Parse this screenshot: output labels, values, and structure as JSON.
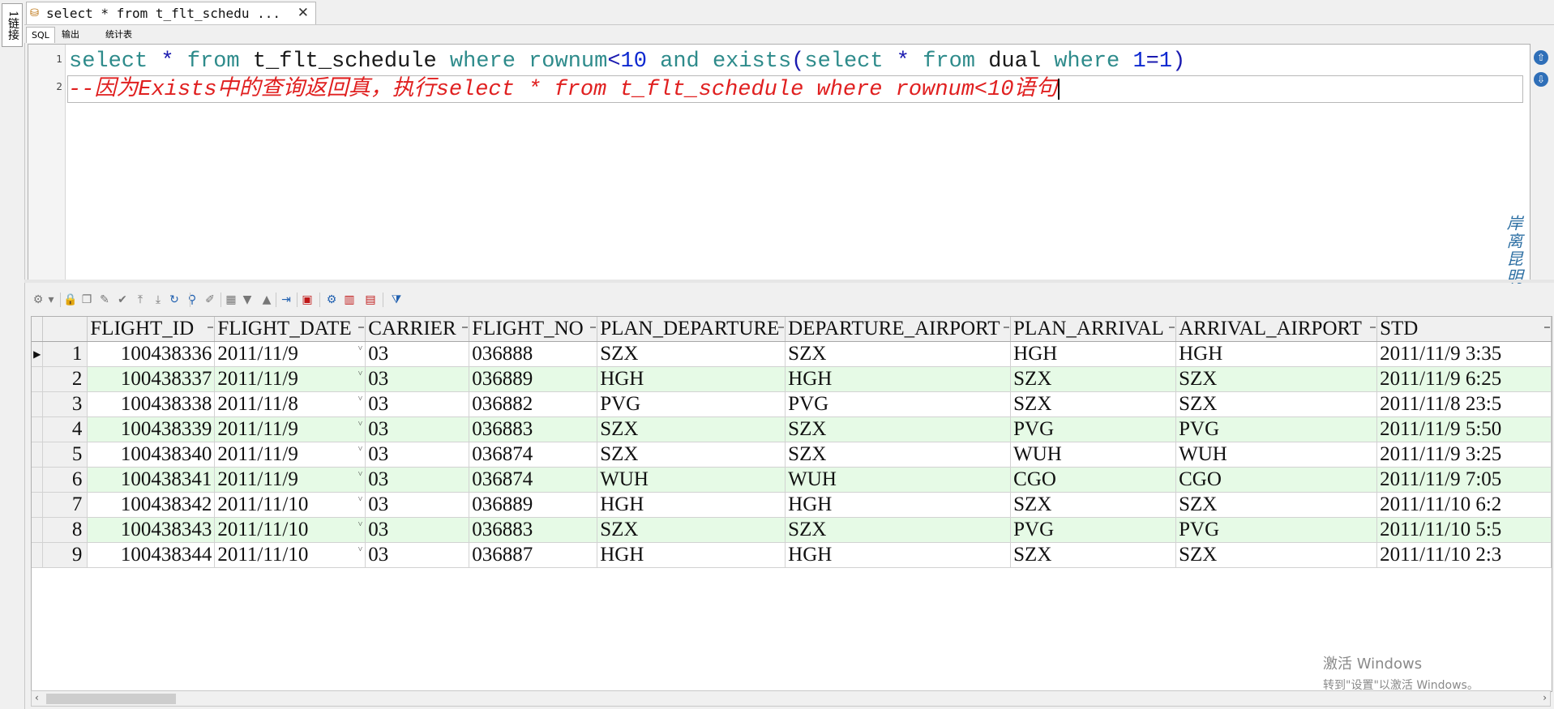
{
  "connection_tab": {
    "label": "1链接"
  },
  "document_tab": {
    "title": "select * from t_flt_schedu ...",
    "close": "✕"
  },
  "subtabs": [
    {
      "label": "SQL"
    },
    {
      "label": "输出"
    },
    {
      "label": "统计表"
    }
  ],
  "editor": {
    "line_numbers": [
      "1",
      "2"
    ],
    "line1": [
      {
        "t": "select",
        "c": "kw"
      },
      {
        "t": " ",
        "c": "id"
      },
      {
        "t": "*",
        "c": "op"
      },
      {
        "t": " ",
        "c": "id"
      },
      {
        "t": "from",
        "c": "kw"
      },
      {
        "t": " t_flt_schedule ",
        "c": "id"
      },
      {
        "t": "where",
        "c": "kw"
      },
      {
        "t": " ",
        "c": "id"
      },
      {
        "t": "rownum",
        "c": "kw"
      },
      {
        "t": "<",
        "c": "op"
      },
      {
        "t": "10",
        "c": "nm"
      },
      {
        "t": " ",
        "c": "id"
      },
      {
        "t": "and",
        "c": "kw"
      },
      {
        "t": " ",
        "c": "id"
      },
      {
        "t": "exists",
        "c": "kw"
      },
      {
        "t": "(",
        "c": "op"
      },
      {
        "t": "select",
        "c": "kw"
      },
      {
        "t": " ",
        "c": "id"
      },
      {
        "t": "*",
        "c": "op"
      },
      {
        "t": " ",
        "c": "id"
      },
      {
        "t": "from",
        "c": "kw"
      },
      {
        "t": " dual ",
        "c": "id"
      },
      {
        "t": "where",
        "c": "kw"
      },
      {
        "t": " ",
        "c": "id"
      },
      {
        "t": "1",
        "c": "nm"
      },
      {
        "t": "=",
        "c": "op"
      },
      {
        "t": "1",
        "c": "nm"
      },
      {
        "t": ")",
        "c": "op"
      }
    ],
    "line2": "--因为Exists中的查询返回真，执行select * from t_flt_schedule where rownum<10语句"
  },
  "nav_buttons": {
    "up": "⇧",
    "down": "⇩"
  },
  "watermark": "岸离昆明十七句",
  "toolbar": {
    "icons": [
      {
        "name": "configure-icon",
        "glyph": "⚙",
        "cls": ""
      },
      {
        "name": "dropdown-arrow-icon",
        "glyph": "▾",
        "cls": ""
      },
      {
        "name": "lock-icon",
        "glyph": "🔒",
        "cls": "red"
      },
      {
        "name": "copy-icon",
        "glyph": "❐",
        "cls": ""
      },
      {
        "name": "edit-icon",
        "glyph": "✎",
        "cls": ""
      },
      {
        "name": "check-icon",
        "glyph": "✔",
        "cls": ""
      },
      {
        "name": "first-record-icon",
        "glyph": "⤒",
        "cls": ""
      },
      {
        "name": "last-record-icon",
        "glyph": "⤓",
        "cls": ""
      },
      {
        "name": "refresh-icon",
        "glyph": "↻",
        "cls": "blue"
      },
      {
        "name": "find-icon",
        "glyph": "⚲",
        "cls": "blue"
      },
      {
        "name": "clear-icon",
        "glyph": "✐",
        "cls": ""
      },
      {
        "name": "grid-view-icon",
        "glyph": "▦",
        "cls": ""
      },
      {
        "name": "sort-down-icon",
        "glyph": "▼",
        "cls": ""
      },
      {
        "name": "sort-up-icon",
        "glyph": "▲",
        "cls": ""
      },
      {
        "name": "export-icon",
        "glyph": "⇥",
        "cls": "blue"
      },
      {
        "name": "save-icon",
        "glyph": "▣",
        "cls": "red"
      },
      {
        "name": "query-icon",
        "glyph": "⚙",
        "cls": "blue"
      },
      {
        "name": "chart-icon",
        "glyph": "▥",
        "cls": "red"
      },
      {
        "name": "table-icon",
        "glyph": "▤",
        "cls": "red"
      },
      {
        "name": "filter-icon",
        "glyph": "⧩",
        "cls": "blue"
      }
    ]
  },
  "grid": {
    "columns": [
      "FLIGHT_ID",
      "FLIGHT_DATE",
      "CARRIER",
      "FLIGHT_NO",
      "PLAN_DEPARTURE",
      "DEPARTURE_AIRPORT",
      "PLAN_ARRIVAL",
      "ARRIVAL_AIRPORT",
      "STD"
    ],
    "current_row_indicator": "▶",
    "dropdown_marker": "˅",
    "rows": [
      {
        "rn": "1",
        "FLIGHT_ID": "100438336",
        "FLIGHT_DATE": "2011/11/9",
        "CARRIER": "03",
        "FLIGHT_NO": "036888",
        "PLAN_DEPARTURE": "SZX",
        "DEPARTURE_AIRPORT": "SZX",
        "PLAN_ARRIVAL": "HGH",
        "ARRIVAL_AIRPORT": "HGH",
        "STD": "2011/11/9 3:35"
      },
      {
        "rn": "2",
        "FLIGHT_ID": "100438337",
        "FLIGHT_DATE": "2011/11/9",
        "CARRIER": "03",
        "FLIGHT_NO": "036889",
        "PLAN_DEPARTURE": "HGH",
        "DEPARTURE_AIRPORT": "HGH",
        "PLAN_ARRIVAL": "SZX",
        "ARRIVAL_AIRPORT": "SZX",
        "STD": "2011/11/9 6:25"
      },
      {
        "rn": "3",
        "FLIGHT_ID": "100438338",
        "FLIGHT_DATE": "2011/11/8",
        "CARRIER": "03",
        "FLIGHT_NO": "036882",
        "PLAN_DEPARTURE": "PVG",
        "DEPARTURE_AIRPORT": "PVG",
        "PLAN_ARRIVAL": "SZX",
        "ARRIVAL_AIRPORT": "SZX",
        "STD": "2011/11/8 23:5"
      },
      {
        "rn": "4",
        "FLIGHT_ID": "100438339",
        "FLIGHT_DATE": "2011/11/9",
        "CARRIER": "03",
        "FLIGHT_NO": "036883",
        "PLAN_DEPARTURE": "SZX",
        "DEPARTURE_AIRPORT": "SZX",
        "PLAN_ARRIVAL": "PVG",
        "ARRIVAL_AIRPORT": "PVG",
        "STD": "2011/11/9 5:50"
      },
      {
        "rn": "5",
        "FLIGHT_ID": "100438340",
        "FLIGHT_DATE": "2011/11/9",
        "CARRIER": "03",
        "FLIGHT_NO": "036874",
        "PLAN_DEPARTURE": "SZX",
        "DEPARTURE_AIRPORT": "SZX",
        "PLAN_ARRIVAL": "WUH",
        "ARRIVAL_AIRPORT": "WUH",
        "STD": "2011/11/9 3:25"
      },
      {
        "rn": "6",
        "FLIGHT_ID": "100438341",
        "FLIGHT_DATE": "2011/11/9",
        "CARRIER": "03",
        "FLIGHT_NO": "036874",
        "PLAN_DEPARTURE": "WUH",
        "DEPARTURE_AIRPORT": "WUH",
        "PLAN_ARRIVAL": "CGO",
        "ARRIVAL_AIRPORT": "CGO",
        "STD": "2011/11/9 7:05"
      },
      {
        "rn": "7",
        "FLIGHT_ID": "100438342",
        "FLIGHT_DATE": "2011/11/10",
        "CARRIER": "03",
        "FLIGHT_NO": "036889",
        "PLAN_DEPARTURE": "HGH",
        "DEPARTURE_AIRPORT": "HGH",
        "PLAN_ARRIVAL": "SZX",
        "ARRIVAL_AIRPORT": "SZX",
        "STD": "2011/11/10 6:2"
      },
      {
        "rn": "8",
        "FLIGHT_ID": "100438343",
        "FLIGHT_DATE": "2011/11/10",
        "CARRIER": "03",
        "FLIGHT_NO": "036883",
        "PLAN_DEPARTURE": "SZX",
        "DEPARTURE_AIRPORT": "SZX",
        "PLAN_ARRIVAL": "PVG",
        "ARRIVAL_AIRPORT": "PVG",
        "STD": "2011/11/10 5:5"
      },
      {
        "rn": "9",
        "FLIGHT_ID": "100438344",
        "FLIGHT_DATE": "2011/11/10",
        "CARRIER": "03",
        "FLIGHT_NO": "036887",
        "PLAN_DEPARTURE": "HGH",
        "DEPARTURE_AIRPORT": "HGH",
        "PLAN_ARRIVAL": "SZX",
        "ARRIVAL_AIRPORT": "SZX",
        "STD": "2011/11/10 2:3"
      }
    ]
  },
  "scrollbar": {
    "left": "‹",
    "right": "›"
  },
  "activation": {
    "title": "激活 Windows",
    "subtitle": "转到\"设置\"以激活 Windows。"
  }
}
